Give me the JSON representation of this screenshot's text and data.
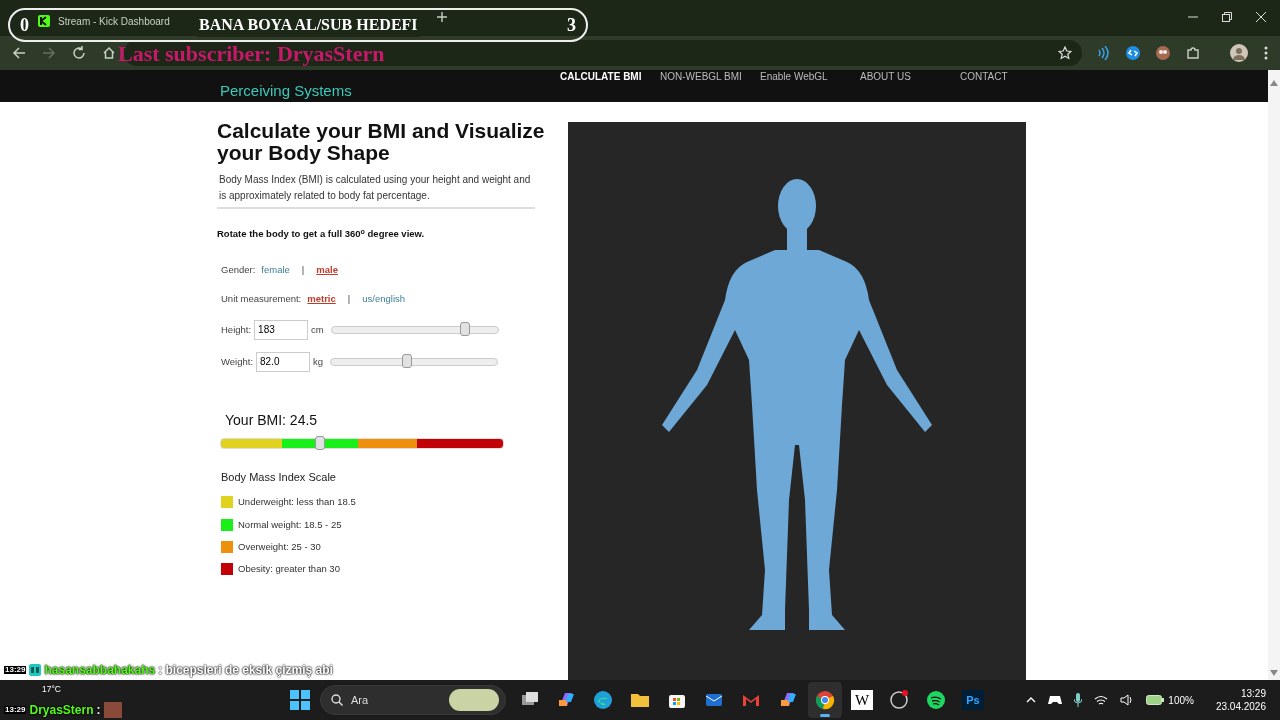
{
  "browser": {
    "tabs": [
      {
        "title": "Stream - Kick Dashboard"
      }
    ]
  },
  "stream_overlay": {
    "goal_start": "0",
    "goal_title": "BANA BOYA AL/SUB HEDEFI",
    "goal_end": "3",
    "last_subscriber": "Last subscriber: DryasStern"
  },
  "site": {
    "tagline": "Perceiving Systems",
    "nav": [
      {
        "label": "CALCULATE BMI",
        "selected": true
      },
      {
        "label": "NON-WEBGL BMI",
        "selected": false
      },
      {
        "label": "Enable WebGL",
        "selected": false
      },
      {
        "label": "ABOUT US",
        "selected": false
      },
      {
        "label": "CONTACT",
        "selected": false
      }
    ],
    "heading": "Calculate your BMI and Visualize your Body Shape",
    "intro": "Body Mass Index (BMI) is calculated using your height and weight and is approximately related to body fat percentage.",
    "rotate_note": "Rotate the body to get a full 360$^{o}$ degree view.",
    "choices": [
      {
        "label": "Gender:",
        "separator": "|",
        "options": [
          {
            "label": "female",
            "selected": false
          },
          {
            "label": "male",
            "selected": true
          }
        ]
      },
      {
        "label": "Unit measurement:",
        "separator": "|",
        "options": [
          {
            "label": "metric",
            "selected": true
          },
          {
            "label": "us/english",
            "selected": false
          }
        ]
      }
    ],
    "measures": [
      {
        "label": "Height:",
        "value": "183",
        "unit": "cm",
        "level": 0.8
      },
      {
        "label": "Weight:",
        "value": "82.0",
        "unit": "kg",
        "level": 0.46
      }
    ],
    "bmi": {
      "label": "Your BMI: 24.5",
      "level": 0.35
    },
    "scale": {
      "title": "Body Mass Index Scale",
      "items": [
        {
          "label": "Underweight: less than 18.5",
          "color": "#e0d21e"
        },
        {
          "label": "Normal weight: 18.5 - 25",
          "color": "#19f019"
        },
        {
          "label": "Overweight: 25 - 30",
          "color": "#ee8f0e"
        },
        {
          "label": "Obesity: greater than 30",
          "color": "#c20008"
        }
      ]
    }
  },
  "chat": [
    {
      "time": "13:29",
      "user": "hasansabbahakahs",
      "message": ": bicepsleri de eksik çizmiş abi",
      "emote": false
    },
    {
      "time": "13:29",
      "user": "DryasStern",
      "message": ":",
      "emote": true
    }
  ],
  "taskbar": {
    "weather": "17°C",
    "search_placeholder": "Ara",
    "apps": [
      {
        "kind": "taskview",
        "selected": false
      },
      {
        "kind": "copilot",
        "selected": false
      },
      {
        "kind": "edge",
        "selected": false
      },
      {
        "kind": "folder",
        "selected": false
      },
      {
        "kind": "store",
        "selected": false
      },
      {
        "kind": "outlook",
        "selected": false
      },
      {
        "kind": "gmail",
        "selected": false
      },
      {
        "kind": "copilot",
        "selected": false
      },
      {
        "kind": "chrome",
        "selected": true
      },
      {
        "kind": "wiki",
        "label": "W",
        "selected": false
      },
      {
        "kind": "obs",
        "selected": false
      },
      {
        "kind": "spotify",
        "selected": false
      },
      {
        "kind": "photoshop",
        "label": "Ps",
        "selected": false
      }
    ],
    "battery": "100%",
    "time": "13:29",
    "date": "23.04.2026"
  }
}
